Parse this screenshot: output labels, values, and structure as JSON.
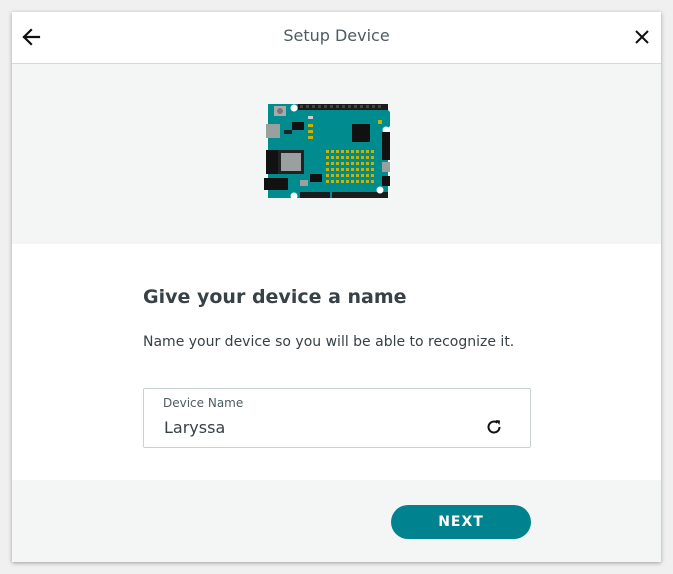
{
  "header": {
    "title": "Setup Device",
    "back_icon": "arrow-left-icon",
    "close_icon": "close-icon"
  },
  "hero": {
    "image": "arduino-board-illustration",
    "board_color": "#008b8f"
  },
  "content": {
    "heading": "Give your device a name",
    "description": "Name your device so you will be able to recognize it.",
    "device_name_field": {
      "label": "Device Name",
      "value": "Laryssa",
      "refresh_icon": "refresh-icon"
    }
  },
  "footer": {
    "next_label": "NEXT",
    "accent_color": "#00838f"
  }
}
